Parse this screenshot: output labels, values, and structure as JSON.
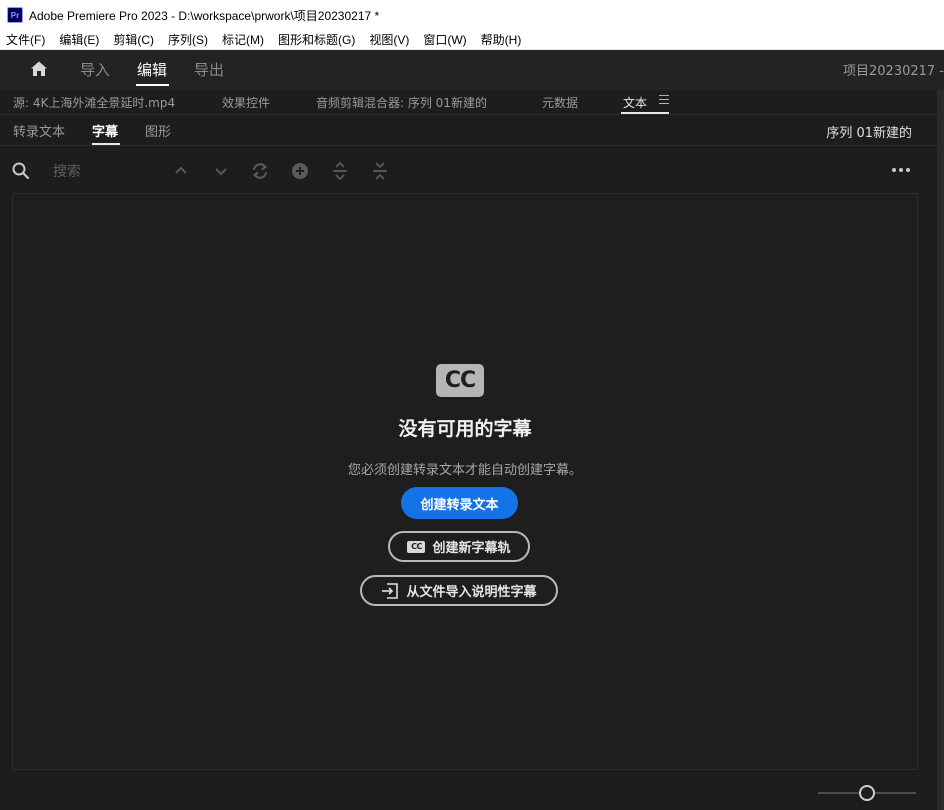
{
  "window": {
    "app_icon_text": "Pr",
    "title": "Adobe Premiere Pro 2023 - D:\\workspace\\prwork\\项目20230217 *"
  },
  "menu": {
    "items": [
      "文件(F)",
      "编辑(E)",
      "剪辑(C)",
      "序列(S)",
      "标记(M)",
      "图形和标题(G)",
      "视图(V)",
      "窗口(W)",
      "帮助(H)"
    ]
  },
  "workspace": {
    "tabs": [
      "导入",
      "编辑",
      "导出"
    ],
    "active_tab": "编辑",
    "project_name": "项目20230217 -"
  },
  "panel_tabs": {
    "items": [
      "源: 4K上海外滩全景延时.mp4",
      "效果控件",
      "音频剪辑混合器: 序列 01新建的",
      "元数据",
      "文本"
    ],
    "active": "文本"
  },
  "text_panel": {
    "subtabs": [
      "转录文本",
      "字幕",
      "图形"
    ],
    "active_subtab": "字幕",
    "sequence_name": "序列 01新建的",
    "search_placeholder": "搜索"
  },
  "empty_state": {
    "logo_text": "CC",
    "small_logo_text": "CC",
    "title": "没有可用的字幕",
    "description": "您必须创建转录文本才能自动创建字幕。",
    "primary_button": "创建转录文本",
    "new_track_button": "创建新字幕轨",
    "import_button": "从文件导入说明性字幕"
  },
  "zoom_level": 0.5,
  "colors": {
    "accent": "#1473e6",
    "background": "#1d1d1d"
  }
}
